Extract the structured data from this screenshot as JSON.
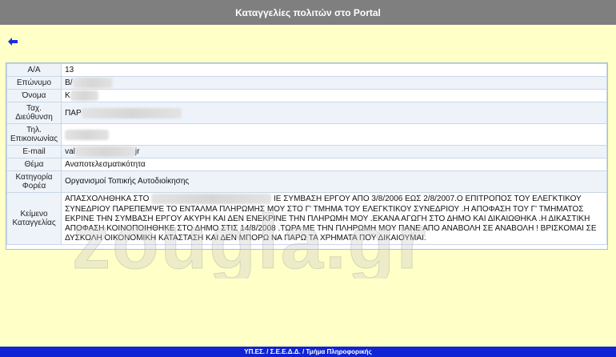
{
  "header": {
    "title": "Καταγγελίες πολιτών στο Portal"
  },
  "back": {
    "icon": "arrow-left-icon",
    "color": "#1a2fd6"
  },
  "record": {
    "rows": [
      {
        "label": "Α/Α",
        "value": "13"
      },
      {
        "label": "Επώνυμο",
        "value": "Β/"
      },
      {
        "label": "Όνομα",
        "value": "Κ"
      },
      {
        "label": "Ταχ. Διεύθυνση",
        "value": "ΠΑΡ"
      },
      {
        "label": "Τηλ. Επικοινωνίας",
        "value": ""
      },
      {
        "label": "E-mail",
        "value": "val",
        "value_suffix": "jr"
      },
      {
        "label": "Θέμα",
        "value": "Αναποτελεσματικότητα"
      },
      {
        "label": "Κατηγορία Φορέα",
        "value": "Οργανισμοί Τοπικής Αυτοδιοίκησης"
      },
      {
        "label": "Κείμενο Καταγγελίας",
        "value_start": "ΑΠΑΣΧΟΛΗΘΗΚΑ ΣΤΟ",
        "value": "ΙΕ ΣΥΜΒΑΣΗ ΕΡΓΟΥ ΑΠΟ 3/8/2006 ΕΩΣ 2/8/2007.Ο ΕΠΙΤΡΟΠΟΣ ΤΟΥ ΕΛΕΓΚΤΙΚΟΥ ΣΥΝΕΔΡΙΟΥ ΠΑΡΕΠΕΜΨΕ ΤΟ ΕΝΤΑΛΜΑ ΠΛΗΡΩΜΗΣ ΜΟΥ ΣΤΟ Γ' ΤΜΗΜΑ ΤΟΥ ΕΛΕΓΚΤΙΚΟΥ ΣΥΝΕΔΡΙΟΥ .Η ΑΠΟΦΑΣΗ ΤΟΥ Γ' ΤΜΗΜΑΤΟΣ ΕΚΡΙΝΕ ΤΗΝ ΣΥΜΒΑΣΗ ΕΡΓΟΥ ΑΚΥΡΗ ΚΑΙ ΔΕΝ ΕΝΕΚΡΙΝΕ ΤΗΝ ΠΛΗΡΩΜΗ ΜΟΥ .ΕΚΑΝΑ ΑΓΩΓΗ ΣΤΟ ΔΗΜΟ ΚΑΙ ΔΙΚΑΙΩΘΗΚΑ .Η ΔΙΚΑΣΤΙΚΗ ΑΠΟΦΑΣΗ ΚΟΙΝΟΠΟΙΗΘΗΚΕ ΣΤΟ ΔΗΜΟ ΣΤΙΣ 14/8/2008 .ΤΩΡΑ ΜΕ ΤΗΝ ΠΛΗΡΩΜΗ ΜΟΥ ΠΑΝΕ ΑΠΟ ΑΝΑΒΟΛΗ ΣΕ ΑΝΑΒΟΛΗ ! ΒΡΙΣΚΟΜΑΙ ΣΕ ΔΥΣΚΟΛΗ ΟΙΚΟΝΟΜΙΚΗ ΚΑΤΑΣΤΑΣΗ ΚΑΙ ΔΕΝ ΜΠΟΡΩ ΝΑ ΠΑΡΩ ΤΑ ΧΡΗΜΑΤΑ ΠΟΥ ΔΙΚΑΙΟΥΜΑΙ."
      }
    ]
  },
  "watermark": {
    "text": "zougla.gr"
  },
  "footer": {
    "text": "ΥΠ.ΕΣ. / Σ.Ε.Ε.Δ.Δ. / Τμήμα Πληροφορικής"
  },
  "colors": {
    "header_bg": "#7f7f7f",
    "page_bg": "#ffffc8",
    "footer_bg": "#0f24d4",
    "row_alt": "#eef3fa"
  }
}
